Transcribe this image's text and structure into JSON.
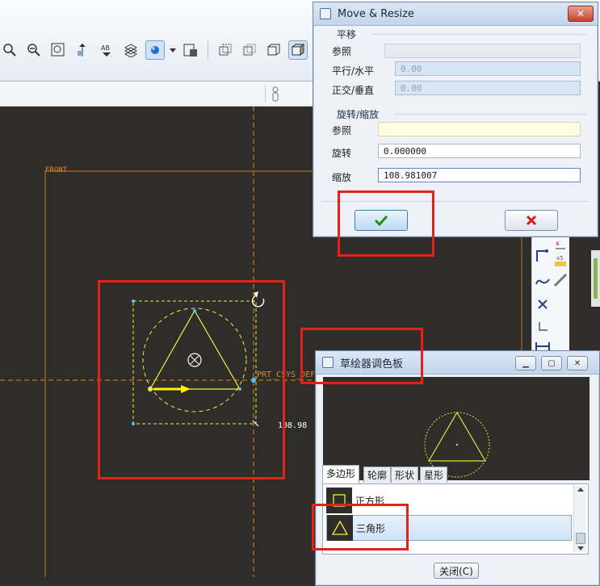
{
  "move_resize": {
    "title": "Move & Resize",
    "translate_group": "平移",
    "translate_ref_label": "参照",
    "horizontal_label": "平行/水平",
    "horizontal_value": "0.00",
    "vertical_label": "正交/垂直",
    "vertical_value": "0.00",
    "rotate_group": "旋转/缩放",
    "rotate_ref_label": "参照",
    "rotation_label": "旋转",
    "rotation_value": "0.000000",
    "scale_label": "缩放",
    "scale_value": "108.981007",
    "ok_icon": "checkmark-icon",
    "cancel_icon": "x-icon"
  },
  "palette": {
    "title": "草绘器调色板",
    "tabs": [
      "多边形",
      "轮廓",
      "形状",
      "星形"
    ],
    "active_tab": "多边形",
    "items": [
      {
        "label": "正方形",
        "icon": "square-icon"
      },
      {
        "label": "三角形",
        "icon": "triangle-icon"
      }
    ],
    "selected_item": "三角形",
    "close_label": "关闭(C)"
  },
  "canvas": {
    "front_label": "FRONT",
    "csys_label": "PRT_CSYS_DEF",
    "dimension_label": "108.98"
  },
  "colors": {
    "canvas_bg": "#2e2d29",
    "datum_orange": "#d98a2b",
    "sketch_yellow": "#f3ee3c",
    "highlight_red": "#e2231a",
    "selection_blue": "#cfe3f8"
  }
}
